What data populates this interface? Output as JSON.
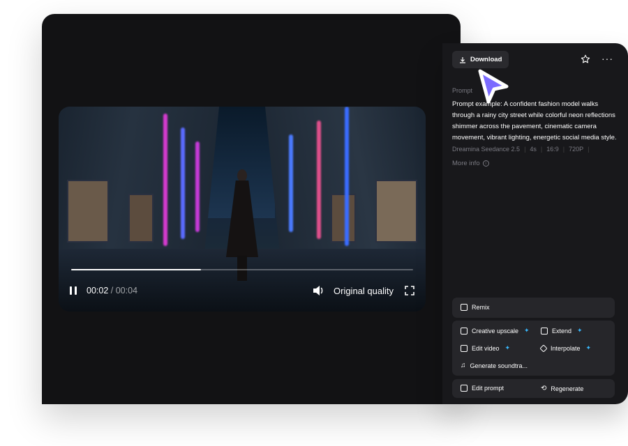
{
  "player": {
    "current_time": "00:02",
    "separator": "/",
    "duration": "00:04",
    "progress": 0.38,
    "quality_label": "Original quality"
  },
  "panel": {
    "download_label": "Download",
    "prompt_label": "Prompt",
    "prompt_text": "Prompt example: A confident fashion model walks through a rainy city street while colorful neon reflections shimmer across the pavement, cinematic camera movement, vibrant lighting, energetic social media style.",
    "meta": {
      "model": "Dreamina Seedance 2.5",
      "duration": "4s",
      "ratio": "16:9",
      "resolution": "720P"
    },
    "more_info_label": "More info"
  },
  "actions": {
    "remix": "Remix",
    "creative_upscale": "Creative upscale",
    "extend": "Extend",
    "edit_video": "Edit video",
    "interpolate": "Interpolate",
    "generate_soundtrack": "Generate soundtra...",
    "edit_prompt": "Edit prompt",
    "regenerate": "Regenerate"
  },
  "colors": {
    "accent": "#39b9ff",
    "cursor": "#7b6bff",
    "panel_bg": "#18181b",
    "card_bg": "#121214"
  }
}
